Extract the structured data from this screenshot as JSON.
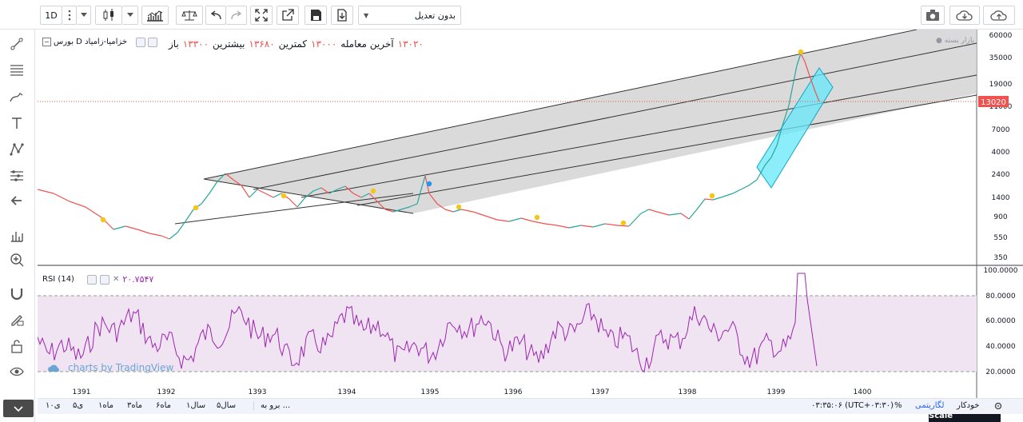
{
  "toolbar": {
    "interval": "1D",
    "adjust_select": "بدون تعدیل"
  },
  "legend": {
    "symbol": "بورس D  خزامیا-زامیاد",
    "open_label": "باز",
    "open_value": "۱۳۳۰۰",
    "high_label": "بیشترین",
    "high_value": "۱۳۶۸۰",
    "low_label": "کمترین",
    "low_value": "۱۳۰۰۰",
    "last_label": "آخرین معامله",
    "last_value": "۱۳۰۲۰",
    "top_right_tag": "بازار بسته"
  },
  "price_axis": {
    "ticks": [
      "60000",
      "35000",
      "19000",
      "11000",
      "7000",
      "4000",
      "2400",
      "1400",
      "900",
      "550",
      "350"
    ],
    "last_price_badge": "13020"
  },
  "rsi": {
    "label": "RSI (14)",
    "value": "۲۰.۷۵۴۷",
    "ticks": [
      "100.0000",
      "80.0000",
      "60.0000",
      "40.0000",
      "20.0000"
    ]
  },
  "time_axis": {
    "ticks": [
      "1391",
      "1392",
      "1393",
      "1394",
      "1395",
      "1396",
      "1397",
      "1398",
      "1399",
      "1400"
    ]
  },
  "watermark": "charts by TradingView",
  "tooltip_text": "Toggle Log Scale",
  "bottom": {
    "ranges": [
      "۱۰ی",
      "۵ی",
      "۱ماه",
      "۳ماه",
      "۶ماه",
      "۱سال",
      "۵سال"
    ],
    "goto": "برو به ...",
    "time": "۰۳:۳۵:۰۶ (UTC+۰۳:۳۰)",
    "percent": "%",
    "log": "لگاریتمی",
    "auto": "خودکار"
  },
  "colors": {
    "up": "#26a69a",
    "down": "#ef5350",
    "channel_fill": "#d3d3d3",
    "rsi_band": "#f0e3f2",
    "rsi_line": "#9c27b0",
    "cyan": "#67e8f9",
    "last_price": "#ef5350"
  }
}
